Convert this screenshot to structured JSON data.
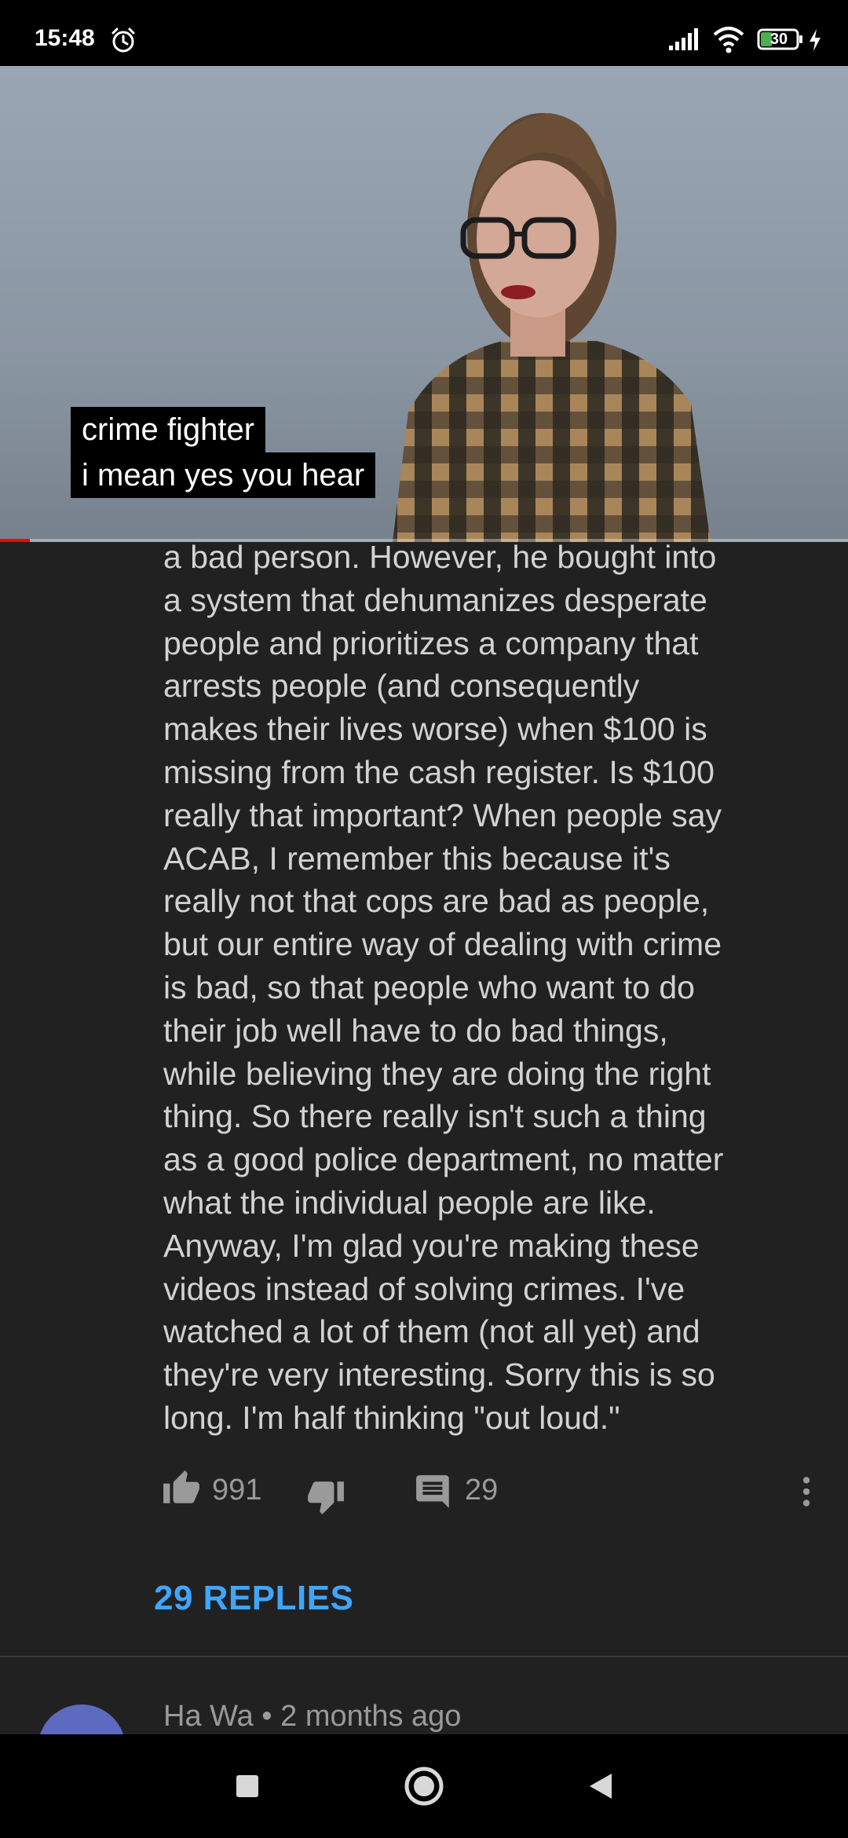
{
  "status_bar": {
    "time": "15:48",
    "battery_level": "30",
    "icons": [
      "alarm-icon",
      "signal-icon",
      "wifi-icon",
      "battery-icon",
      "charging-icon"
    ]
  },
  "video": {
    "captions": [
      "crime fighter",
      "i mean yes you hear"
    ],
    "progress": 0.035,
    "progress_color": "#ff0000"
  },
  "comment": {
    "text": "a bad person. However, he bought into\na system that dehumanizes desperate\npeople and prioritizes a company that\narrests people (and consequently\nmakes their lives worse) when $100 is\nmissing from the cash register. Is $100\nreally that important? When people say\nACAB, I remember this because it's\nreally not that cops are bad as people,\nbut our entire way of dealing with crime\nis bad, so that people who want to do\ntheir job well have to do bad things,\nwhile believing they are doing the right\nthing. So there really isn't such a thing\nas a good police department, no matter\nwhat the individual people are like.\nAnyway, I'm glad you're making these\nvideos instead of solving crimes. I've\nwatched a lot of them (not all yet) and\nthey're very interesting. Sorry this is so\nlong. I'm half thinking \"out loud.\"",
    "likes": "991",
    "replies_count": "29",
    "replies_label": "29 REPLIES",
    "icons": [
      "thumb-up-icon",
      "thumb-down-icon",
      "reply-icon",
      "more-vert-icon"
    ]
  },
  "next_comment": {
    "header": "Ha Wa • 2 months ago"
  },
  "colors": {
    "background": "#212121",
    "text": "#d2d2d2",
    "secondary_text": "#9a9a9a",
    "link": "#3ea6ff"
  },
  "nav_bar": {
    "icons": [
      "recents-square-icon",
      "home-circle-icon",
      "back-triangle-icon"
    ]
  }
}
